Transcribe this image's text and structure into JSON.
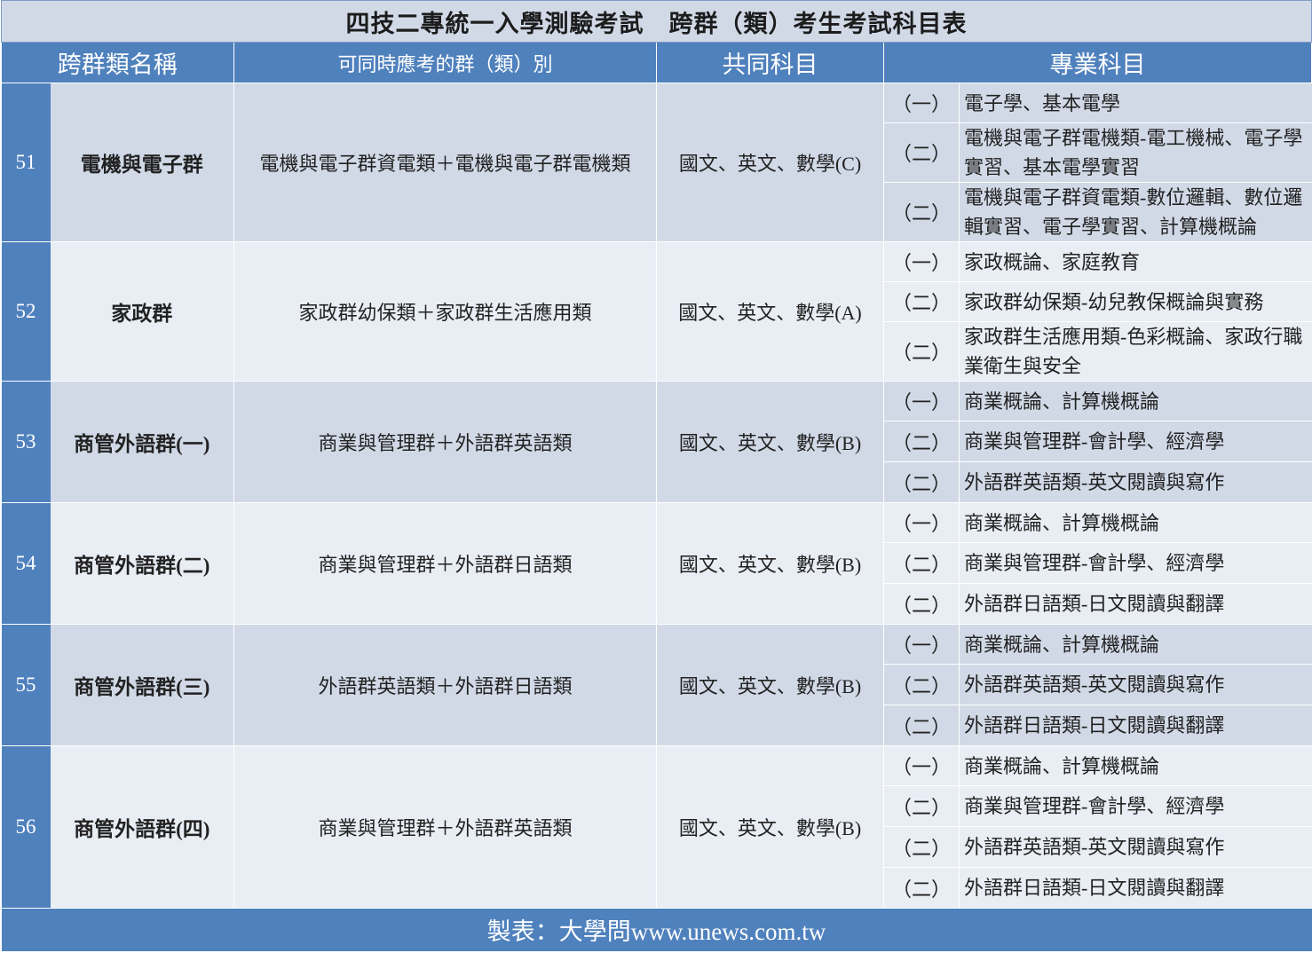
{
  "title": "四技二專統一入學測驗考試　跨群（類）考生考試科目表",
  "headers": {
    "name": "跨群類名稱",
    "combo": "可同時應考的群（類）別",
    "common": "共同科目",
    "pro": "專業科目"
  },
  "groups": [
    {
      "num": "51",
      "name": "電機與電子群",
      "combo": "電機與電子群資電類＋電機與電子群電機類",
      "common": "國文、英文、數學(C)",
      "subjects": [
        {
          "idx": "（一）",
          "text": "電子學、基本電學"
        },
        {
          "idx": "（二）",
          "text": "電機與電子群電機類-電工機械、電子學實習、基本電學實習"
        },
        {
          "idx": "（二）",
          "text": "電機與電子群資電類-數位邏輯、數位邏輯實習、電子學實習、計算機概論"
        }
      ]
    },
    {
      "num": "52",
      "name": "家政群",
      "combo": "家政群幼保類＋家政群生活應用類",
      "common": "國文、英文、數學(A)",
      "subjects": [
        {
          "idx": "（一）",
          "text": "家政概論、家庭教育"
        },
        {
          "idx": "（二）",
          "text": "家政群幼保類-幼兒教保概論與實務"
        },
        {
          "idx": "（二）",
          "text": "家政群生活應用類-色彩概論、家政行職業衛生與安全"
        }
      ]
    },
    {
      "num": "53",
      "name": "商管外語群(一)",
      "combo": "商業與管理群＋外語群英語類",
      "common": "國文、英文、數學(B)",
      "subjects": [
        {
          "idx": "（一）",
          "text": "商業概論、計算機概論"
        },
        {
          "idx": "（二）",
          "text": "商業與管理群-會計學、經濟學"
        },
        {
          "idx": "（二）",
          "text": "外語群英語類-英文閱讀與寫作"
        }
      ]
    },
    {
      "num": "54",
      "name": "商管外語群(二)",
      "combo": "商業與管理群＋外語群日語類",
      "common": "國文、英文、數學(B)",
      "subjects": [
        {
          "idx": "（一）",
          "text": "商業概論、計算機概論"
        },
        {
          "idx": "（二）",
          "text": "商業與管理群-會計學、經濟學"
        },
        {
          "idx": "（二）",
          "text": "外語群日語類-日文閱讀與翻譯"
        }
      ]
    },
    {
      "num": "55",
      "name": "商管外語群(三)",
      "combo": "外語群英語類＋外語群日語類",
      "common": "國文、英文、數學(B)",
      "subjects": [
        {
          "idx": "（一）",
          "text": "商業概論、計算機概論"
        },
        {
          "idx": "（二）",
          "text": "外語群英語類-英文閱讀與寫作"
        },
        {
          "idx": "（二）",
          "text": "外語群日語類-日文閱讀與翻譯"
        }
      ]
    },
    {
      "num": "56",
      "name": "商管外語群(四)",
      "combo": "商業與管理群＋外語群英語類",
      "common": "國文、英文、數學(B)",
      "subjects": [
        {
          "idx": "（一）",
          "text": "商業概論、計算機概論"
        },
        {
          "idx": "（二）",
          "text": "商業與管理群-會計學、經濟學"
        },
        {
          "idx": "（二）",
          "text": "外語群英語類-英文閱讀與寫作"
        },
        {
          "idx": "（二）",
          "text": "外語群日語類-日文閱讀與翻譯"
        }
      ]
    }
  ],
  "footer": "製表：大學問www.unews.com.tw",
  "colors": {
    "header_blue": "#4f81bd",
    "row_dark": "#d1d9e7",
    "row_light": "#e9edf4"
  }
}
